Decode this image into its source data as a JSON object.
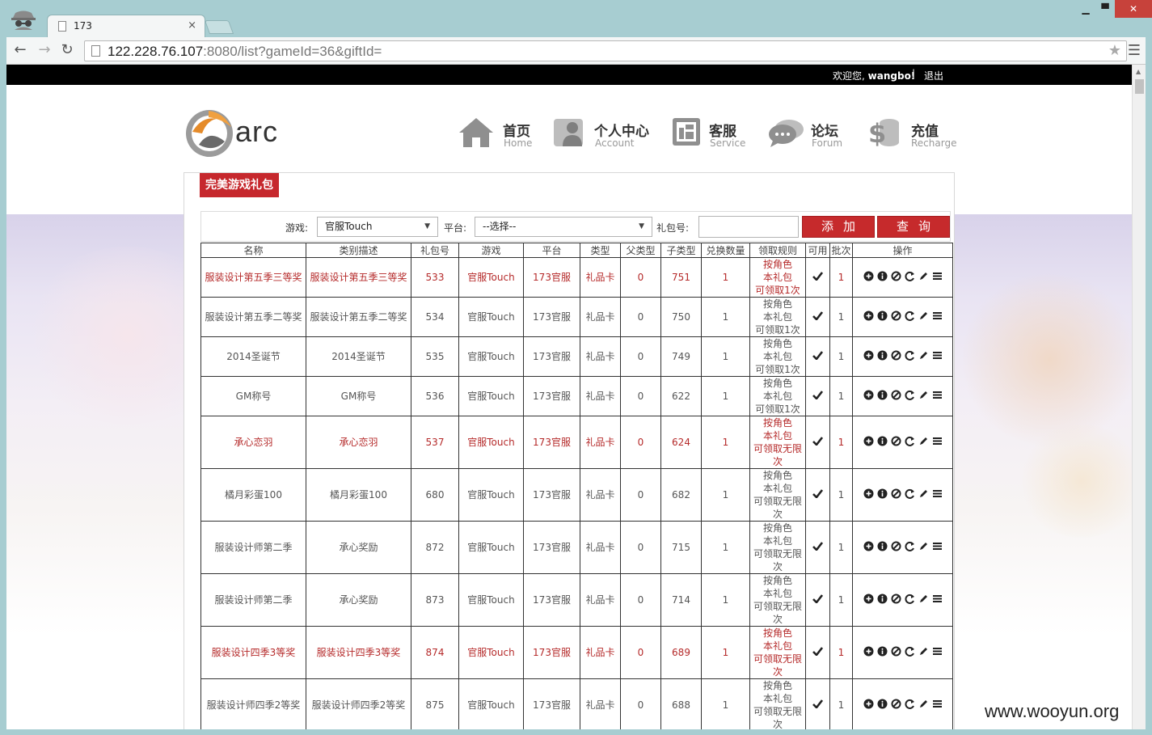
{
  "browser": {
    "tab_title": "173",
    "tab_close": "×",
    "url_host": "122.228.76.107",
    "url_rest": ":8080/list?gameId=36&giftId=",
    "window_minimize": "▁",
    "window_maximize": "▀",
    "window_close": "✕"
  },
  "topbar": {
    "welcome_prefix": "欢迎您,",
    "username": "wangbo!",
    "separator": "|",
    "logout": "退出"
  },
  "logo_text": "arc",
  "nav": [
    {
      "zh": "首页",
      "en": "Home",
      "icon": "home-icon"
    },
    {
      "zh": "个人中心",
      "en": "Account",
      "icon": "account-icon"
    },
    {
      "zh": "客服",
      "en": "Service",
      "icon": "service-icon"
    },
    {
      "zh": "论坛",
      "en": "Forum",
      "icon": "forum-icon"
    },
    {
      "zh": "充值",
      "en": "Recharge",
      "icon": "recharge-icon"
    }
  ],
  "panel_title": "完美游戏礼包",
  "filter": {
    "game_label": "游戏:",
    "game_value": "官服Touch",
    "platform_label": "平台:",
    "platform_value": "--选择--",
    "gift_label": "礼包号:",
    "gift_value": "",
    "add_button": "添加",
    "query_button": "查询"
  },
  "table": {
    "headers": [
      "名称",
      "类别描述",
      "礼包号",
      "游戏",
      "平台",
      "类型",
      "父类型",
      "子类型",
      "兑换数量",
      "领取规则",
      "可用",
      "批次",
      "操作"
    ],
    "rows": [
      {
        "red": true,
        "name": "服装设计第五季三等奖",
        "desc": "服装设计第五季三等奖",
        "gift": "533",
        "game": "官服Touch",
        "platform": "173官服",
        "type": "礼品卡",
        "parent": "0",
        "child": "751",
        "qty": "1",
        "rule": [
          "按角色",
          "本礼包",
          "可领取1次"
        ],
        "batch": "1"
      },
      {
        "red": false,
        "name": "服装设计第五季二等奖",
        "desc": "服装设计第五季二等奖",
        "gift": "534",
        "game": "官服Touch",
        "platform": "173官服",
        "type": "礼品卡",
        "parent": "0",
        "child": "750",
        "qty": "1",
        "rule": [
          "按角色",
          "本礼包",
          "可领取1次"
        ],
        "batch": "1"
      },
      {
        "red": false,
        "name": "2014圣诞节",
        "desc": "2014圣诞节",
        "gift": "535",
        "game": "官服Touch",
        "platform": "173官服",
        "type": "礼品卡",
        "parent": "0",
        "child": "749",
        "qty": "1",
        "rule": [
          "按角色",
          "本礼包",
          "可领取1次"
        ],
        "batch": "1"
      },
      {
        "red": false,
        "name": "GM称号",
        "desc": "GM称号",
        "gift": "536",
        "game": "官服Touch",
        "platform": "173官服",
        "type": "礼品卡",
        "parent": "0",
        "child": "622",
        "qty": "1",
        "rule": [
          "按角色",
          "本礼包",
          "可领取1次"
        ],
        "batch": "1"
      },
      {
        "red": true,
        "name": "承心恋羽",
        "desc": "承心恋羽",
        "gift": "537",
        "game": "官服Touch",
        "platform": "173官服",
        "type": "礼品卡",
        "parent": "0",
        "child": "624",
        "qty": "1",
        "rule": [
          "按角色",
          "本礼包",
          "可领取无限",
          "次"
        ],
        "batch": "1"
      },
      {
        "red": false,
        "name": "橘月彩蛋100",
        "desc": "橘月彩蛋100",
        "gift": "680",
        "game": "官服Touch",
        "platform": "173官服",
        "type": "礼品卡",
        "parent": "0",
        "child": "682",
        "qty": "1",
        "rule": [
          "按角色",
          "本礼包",
          "可领取无限",
          "次"
        ],
        "batch": "1"
      },
      {
        "red": false,
        "name": "服装设计师第二季",
        "desc": "承心奖励",
        "gift": "872",
        "game": "官服Touch",
        "platform": "173官服",
        "type": "礼品卡",
        "parent": "0",
        "child": "715",
        "qty": "1",
        "rule": [
          "按角色",
          "本礼包",
          "可领取无限",
          "次"
        ],
        "batch": "1"
      },
      {
        "red": false,
        "name": "服装设计师第二季",
        "desc": "承心奖励",
        "gift": "873",
        "game": "官服Touch",
        "platform": "173官服",
        "type": "礼品卡",
        "parent": "0",
        "child": "714",
        "qty": "1",
        "rule": [
          "按角色",
          "本礼包",
          "可领取无限",
          "次"
        ],
        "batch": "1"
      },
      {
        "red": true,
        "name": "服装设计四季3等奖",
        "desc": "服装设计四季3等奖",
        "gift": "874",
        "game": "官服Touch",
        "platform": "173官服",
        "type": "礼品卡",
        "parent": "0",
        "child": "689",
        "qty": "1",
        "rule": [
          "按角色",
          "本礼包",
          "可领取无限",
          "次"
        ],
        "batch": "1"
      },
      {
        "red": false,
        "name": "服装设计师四季2等奖",
        "desc": "服装设计师四季2等奖",
        "gift": "875",
        "game": "官服Touch",
        "platform": "173官服",
        "type": "礼品卡",
        "parent": "0",
        "child": "688",
        "qty": "1",
        "rule": [
          "按角色",
          "本礼包",
          "可领取无限",
          "次"
        ],
        "batch": "1"
      }
    ],
    "available_icon": "check-icon",
    "operation_icons": [
      "add-circle-icon",
      "info-circle-icon",
      "ban-icon",
      "refresh-icon",
      "edit-pencil-icon",
      "list-icon"
    ]
  },
  "watermark": "www.wooyun.org",
  "colors": {
    "brand_red": "#c6282d",
    "row_red_text": "#b52a2a",
    "topbar": "#000000"
  }
}
